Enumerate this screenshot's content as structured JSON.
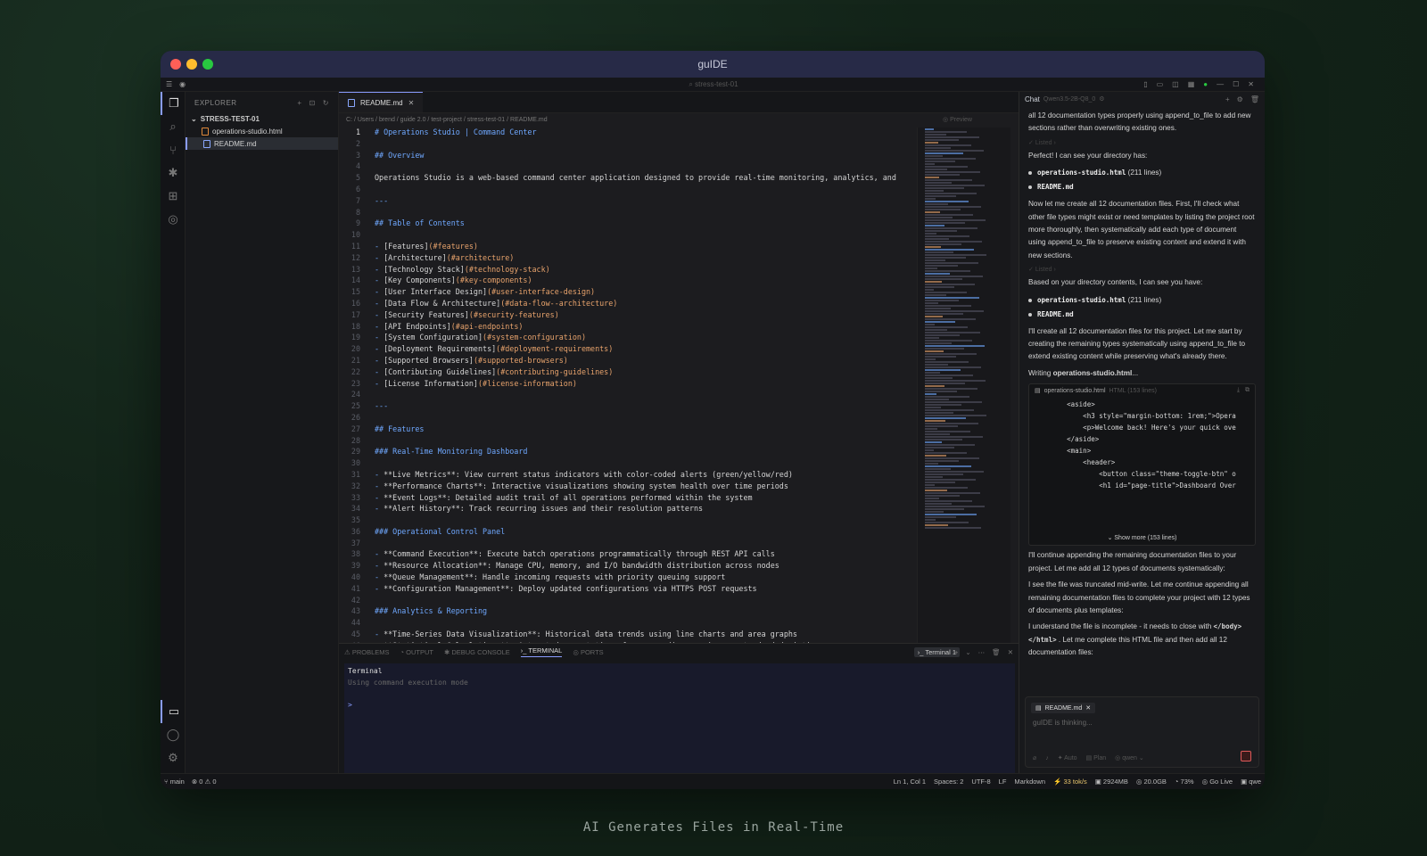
{
  "window": {
    "title": "guIDE"
  },
  "menubar": {
    "search_placeholder": "stress-test-01"
  },
  "explorer": {
    "header": "EXPLORER",
    "folder": "STRESS-TEST-01",
    "files": [
      {
        "name": "operations-studio.html",
        "type": "html"
      },
      {
        "name": "README.md",
        "type": "md"
      }
    ]
  },
  "editor": {
    "tab_label": "README.md",
    "breadcrumb": "C: / Users / brend / guide 2.0 / test-project / stress-test-01 / README.md",
    "preview_label": "Preview",
    "lines": [
      "# Operations Studio | Command Center",
      "",
      "## Overview",
      "",
      "Operations Studio is a web-based command center application designed to provide real-time monitoring, analytics, and",
      "",
      "---",
      "",
      "## Table of Contents",
      "",
      "- [Features](#features)",
      "- [Architecture](#architecture)",
      "- [Technology Stack](#technology-stack)",
      "- [Key Components](#key-components)",
      "- [User Interface Design](#user-interface-design)",
      "- [Data Flow & Architecture](#data-flow--architecture)",
      "- [Security Features](#security-features)",
      "- [API Endpoints](#api-endpoints)",
      "- [System Configuration](#system-configuration)",
      "- [Deployment Requirements](#deployment-requirements)",
      "- [Supported Browsers](#supported-browsers)",
      "- [Contributing Guidelines](#contributing-guidelines)",
      "- [License Information](#license-information)",
      "",
      "---",
      "",
      "## Features",
      "",
      "### Real-Time Monitoring Dashboard",
      "",
      "- **Live Metrics**: View current status indicators with color-coded alerts (green/yellow/red)",
      "- **Performance Charts**: Interactive visualizations showing system health over time periods",
      "- **Event Logs**: Detailed audit trail of all operations performed within the system",
      "- **Alert History**: Track recurring issues and their resolution patterns",
      "",
      "### Operational Control Panel",
      "",
      "- **Command Execution**: Execute batch operations programmatically through REST API calls",
      "- **Resource Allocation**: Manage CPU, memory, and I/O bandwidth distribution across nodes",
      "- **Queue Management**: Handle incoming requests with priority queuing support",
      "- **Configuration Management**: Deploy updated configurations via HTTPS POST requests",
      "",
      "### Analytics & Reporting",
      "",
      "- **Time-Series Data Visualization**: Historical data trends using line charts and area graphs",
      "- **Statistical Calculations**: Automated computation of mean, median, variance, standard deviation"
    ]
  },
  "panel": {
    "tabs": [
      "PROBLEMS",
      "OUTPUT",
      "DEBUG CONSOLE",
      "TERMINAL",
      "PORTS"
    ],
    "terminal_badge": "Terminal 1",
    "terminal_title": "Terminal",
    "terminal_mode": "Using command execution mode",
    "prompt": ">"
  },
  "chat": {
    "title": "Chat",
    "model": "Qwen3.5-2B-Q8_0",
    "intro": "all 12 documentation types properly using append_to_file to add new sections rather than overwriting existing ones.",
    "listed_label": "Listed",
    "p1": "Perfect! I can see your directory has:",
    "files": [
      {
        "name": "operations-studio.html",
        "meta": "(211 lines)"
      },
      {
        "name": "README.md",
        "meta": ""
      }
    ],
    "p2": "Now let me create all 12 documentation files. First, I'll check what other file types might exist or need templates by listing the project root more thoroughly, then systematically add each type of document using append_to_file to preserve existing content and extend it with new sections.",
    "p3": "Based on your directory contents, I can see you have:",
    "p4": "I'll create all 12 documentation files for this project. Let me start by creating the remaining types systematically using append_to_file to extend existing content while preserving what's already there.",
    "writing_prefix": "Writing",
    "writing_file": "operations-studio.html",
    "writing_suffix": "...",
    "codecard": {
      "file": "operations-studio.html",
      "meta": "HTML (153 lines)",
      "code": "        <aside>\n            <h3 style=\"margin-bottom: 1rem;\">Opera\n            <p>Welcome back! Here's your quick ove\n        </aside>\n        <main>\n            <header>\n                <button class=\"theme-toggle-btn\" o\n                <h1 id=\"page-title\">Dashboard Over",
      "show_more": "Show more (153 lines)"
    },
    "p5": "I'll continue appending the remaining documentation files to your project. Let me add all 12 types of documents systematically:",
    "p6": "I see the file was truncated mid-write. Let me continue appending all remaining documentation files to complete your project with 12 types of documents plus templates:",
    "p7_a": "I understand the file is incomplete - it needs to close with",
    "p7_code": "</body></html>",
    "p7_b": ". Let me complete this HTML file and then add all 12 documentation files:",
    "attached_chip": "README.md",
    "input_placeholder": "guIDE is thinking...",
    "footer_auto": "Auto",
    "footer_plan": "Plan",
    "footer_model": "qwen"
  },
  "statusbar": {
    "branch": "main",
    "problems": "0",
    "warnings": "0",
    "position": "Ln 1, Col 1",
    "spaces": "Spaces: 2",
    "encoding": "UTF-8",
    "eol": "LF",
    "language": "Markdown",
    "speed": "33 tok/s",
    "memory": "2924MB",
    "disk": "20.0GB",
    "cpu": "73%",
    "golive": "Go Live",
    "model": "qwe"
  },
  "caption": "AI Generates Files in Real-Time",
  "colors": {
    "accent": "#8a9cff",
    "titlebar": "#272a47",
    "heading": "#6fa8ff",
    "link": "#e8a36c"
  }
}
